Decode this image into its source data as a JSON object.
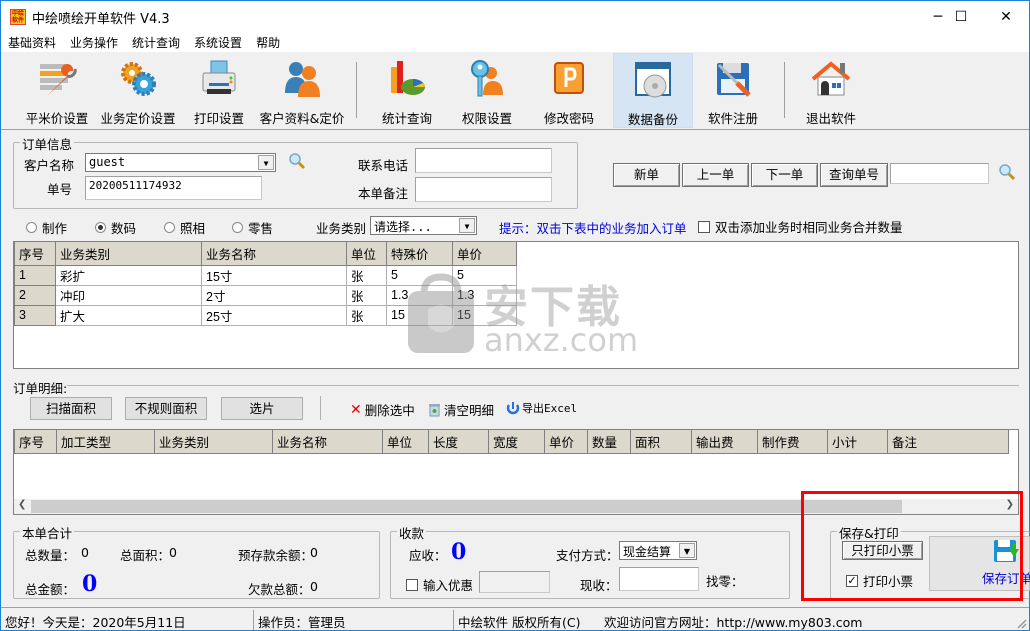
{
  "window": {
    "title": "中绘喷绘开单软件 V4.3",
    "logo_text": "中绘软件",
    "controls": {
      "minimize": "─",
      "maximize": "☐",
      "close": "✕"
    }
  },
  "menu": [
    "基础资料",
    "业务操作",
    "统计查询",
    "系统设置",
    "帮助"
  ],
  "toolbar": [
    {
      "label": "平米价设置",
      "icon": "list-wrench-icon"
    },
    {
      "label": "业务定价设置",
      "icon": "gears-icon"
    },
    {
      "label": "打印设置",
      "icon": "printer-icon"
    },
    {
      "label": "客户资料&定价",
      "icon": "users-icon"
    },
    {
      "label": "统计查询",
      "icon": "chart-icon"
    },
    {
      "label": "权限设置",
      "icon": "key-user-icon"
    },
    {
      "label": "修改密码",
      "icon": "password-icon"
    },
    {
      "label": "数据备份",
      "icon": "disc-backup-icon",
      "active": true
    },
    {
      "label": "软件注册",
      "icon": "floppy-screwdriver-icon"
    },
    {
      "label": "退出软件",
      "icon": "house-icon"
    }
  ],
  "order_info": {
    "title": "订单信息",
    "customer_label": "客户名称",
    "customer_value": "guest",
    "order_no_label": "单号",
    "order_no_value": "20200511174932",
    "phone_label": "联系电话",
    "phone_value": "",
    "remark_label": "本单备注",
    "remark_value": ""
  },
  "nav_buttons": {
    "new": "新单",
    "prev": "上一单",
    "next": "下一单",
    "query": "查询单号",
    "query_input": ""
  },
  "business": {
    "radios": [
      {
        "label": "制作",
        "checked": false
      },
      {
        "label": "数码",
        "checked": true
      },
      {
        "label": "照相",
        "checked": false
      },
      {
        "label": "零售",
        "checked": false
      }
    ],
    "category_label": "业务类别",
    "category_value": "请选择...",
    "hint": "提示：双击下表中的业务加入订单",
    "merge_checkbox": {
      "label": "双击添加业务时相同业务合并数量",
      "checked": false
    }
  },
  "service_table": {
    "columns": [
      "序号",
      "业务类别",
      "业务名称",
      "单位",
      "特殊价",
      "单价"
    ],
    "rows": [
      [
        "1",
        "彩扩",
        "15寸",
        "张",
        "5",
        "5"
      ],
      [
        "2",
        "冲印",
        "2寸",
        "张",
        "1.3",
        "1.3"
      ],
      [
        "3",
        "扩大",
        "25寸",
        "张",
        "15",
        "15"
      ]
    ]
  },
  "watermark": {
    "cn": "安下载",
    "en": "anxz.com"
  },
  "detail": {
    "title": "订单明细:",
    "buttons": [
      "扫描面积",
      "不规则面积",
      "选片"
    ],
    "actions": [
      {
        "label": "删除选中",
        "icon": "delete-x-icon"
      },
      {
        "label": "清空明细",
        "icon": "trash-icon"
      },
      {
        "label": "导出Excel",
        "icon": "export-icon"
      }
    ],
    "columns": [
      "序号",
      "加工类型",
      "业务类别",
      "业务名称",
      "单位",
      "长度",
      "宽度",
      "单价",
      "数量",
      "面积",
      "输出费",
      "制作费",
      "小计",
      "备注"
    ],
    "rows": []
  },
  "totals": {
    "title": "本单合计",
    "qty_label": "总数量：",
    "qty_value": "0",
    "area_label": "总面积：",
    "area_value": "0",
    "prepaid_label": "预存款余额：",
    "prepaid_value": "0",
    "amount_label": "总金额：",
    "amount_value": "0",
    "debt_label": "欠款总额：",
    "debt_value": "0"
  },
  "payment": {
    "title": "收款",
    "receivable_label": "应收：",
    "receivable_value": "0",
    "method_label": "支付方式：",
    "method_value": "现金结算",
    "discount_label": "输入优惠",
    "discount_checked": false,
    "discount_value": "",
    "received_label": "现收：",
    "received_value": "",
    "change_label": "找零："
  },
  "save_print": {
    "title": "保存&打印",
    "print_only": "只打印小票",
    "print_receipt": {
      "label": "打印小票",
      "checked": true
    },
    "save_order": "保存订单"
  },
  "status": {
    "greeting": "您好！今天是：2020年5月11日",
    "operator": "操作员：管理员",
    "copyright": "中绘软件 版权所有(C)",
    "website": "欢迎访问官方网址：http://www.my803.com"
  }
}
